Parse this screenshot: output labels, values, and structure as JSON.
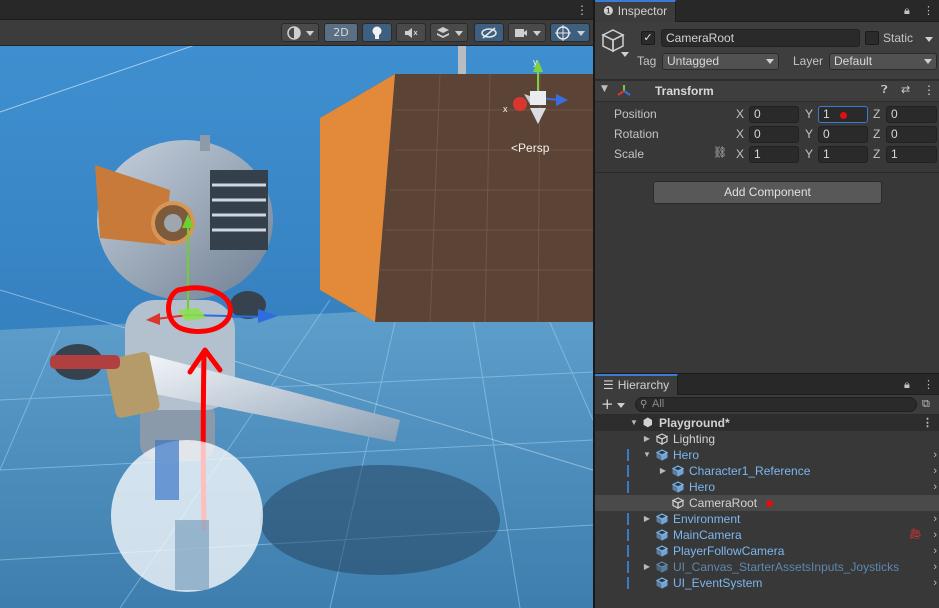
{
  "scene": {
    "view_mode": "2D",
    "persp_label": "Persp",
    "gizmo_axes": {
      "y": "y",
      "x": "x"
    },
    "toolbar_icons": [
      "shading-mode-icon",
      "2d-toggle",
      "lighting-icon",
      "audio-icon",
      "effects-icon",
      "scene-visibility-icon",
      "camera-icon",
      "gizmos-icon"
    ]
  },
  "inspector": {
    "tab_label": "Inspector",
    "object_name": "CameraRoot",
    "active": true,
    "static_label": "Static",
    "tag_label": "Tag",
    "tag_value": "Untagged",
    "layer_label": "Layer",
    "layer_value": "Default",
    "component": {
      "name": "Transform",
      "rows": [
        {
          "label": "Position",
          "x": "0",
          "y": "1",
          "z": "0"
        },
        {
          "label": "Rotation",
          "x": "0",
          "y": "0",
          "z": "0"
        },
        {
          "label": "Scale",
          "x": "1",
          "y": "1",
          "z": "1"
        }
      ],
      "axis_x": "X",
      "axis_y": "Y",
      "axis_z": "Z"
    },
    "add_component_label": "Add Component"
  },
  "hierarchy": {
    "tab_label": "Hierarchy",
    "search_placeholder": "All",
    "scene_name": "Playground*",
    "items": [
      {
        "label": "Lighting",
        "depth": 1,
        "expandable": true,
        "kind": "object"
      },
      {
        "label": "Hero",
        "depth": 1,
        "expandable": true,
        "expanded": true,
        "kind": "prefab"
      },
      {
        "label": "Character1_Reference",
        "depth": 2,
        "expandable": true,
        "kind": "prefab"
      },
      {
        "label": "Hero",
        "depth": 2,
        "expandable": false,
        "kind": "prefab"
      },
      {
        "label": "CameraRoot",
        "depth": 2,
        "expandable": false,
        "kind": "object",
        "selected": true
      },
      {
        "label": "Environment",
        "depth": 1,
        "expandable": true,
        "kind": "prefab"
      },
      {
        "label": "MainCamera",
        "depth": 1,
        "expandable": false,
        "kind": "prefab"
      },
      {
        "label": "PlayerFollowCamera",
        "depth": 1,
        "expandable": false,
        "kind": "prefab"
      },
      {
        "label": "UI_Canvas_StarterAssetsInputs_Joysticks",
        "depth": 1,
        "expandable": true,
        "kind": "prefab-dim"
      },
      {
        "label": "UI_EventSystem",
        "depth": 1,
        "expandable": false,
        "kind": "prefab"
      }
    ]
  },
  "colors": {
    "accent": "#3a7bd5",
    "annotation_red": "#ff0000",
    "prefab_blue": "#7bb7f0"
  }
}
